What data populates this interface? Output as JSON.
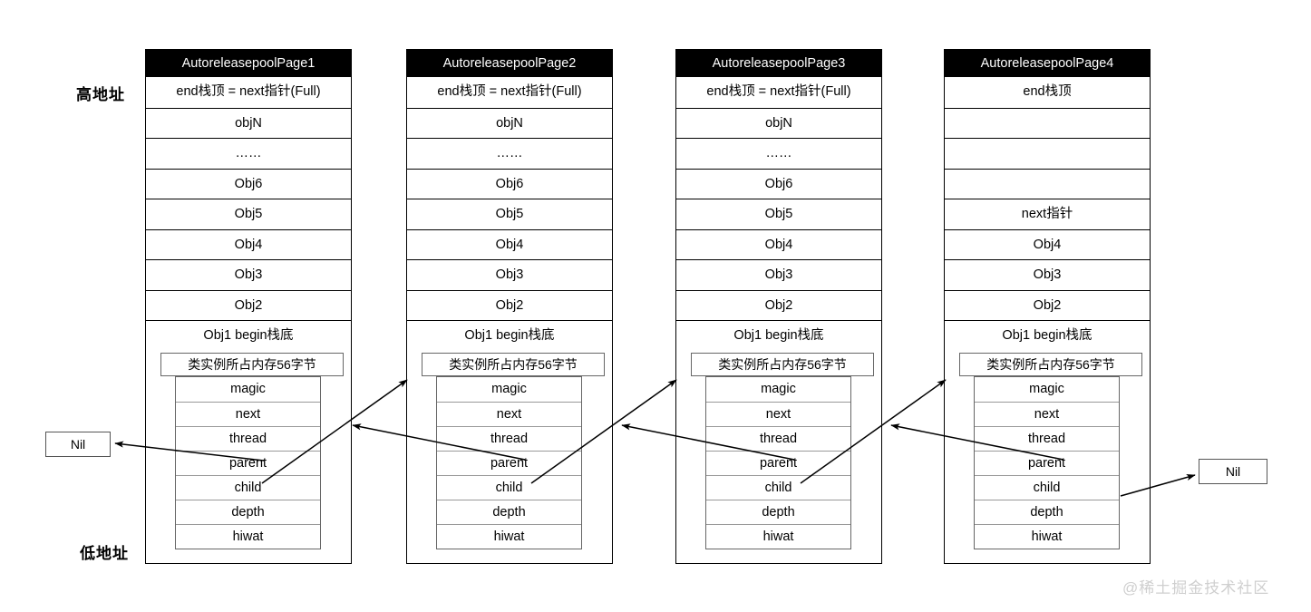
{
  "labels": {
    "high_address": "高地址",
    "low_address": "低地址"
  },
  "watermark": "@稀土掘金技术社区",
  "nil_left": "Nil",
  "nil_right": "Nil",
  "pages": [
    {
      "title": "AutoreleasepoolPage1",
      "slots": [
        "end栈顶 = next指针(Full)",
        "objN",
        "……",
        "Obj6",
        "Obj5",
        "Obj4",
        "Obj3",
        "Obj2",
        "Obj1 begin栈底"
      ],
      "struct_title": "类实例所占内存56字节",
      "fields": [
        "magic",
        "next",
        "thread",
        "parent",
        "child",
        "depth",
        "hiwat"
      ]
    },
    {
      "title": "AutoreleasepoolPage2",
      "slots": [
        "end栈顶 = next指针(Full)",
        "objN",
        "……",
        "Obj6",
        "Obj5",
        "Obj4",
        "Obj3",
        "Obj2",
        "Obj1 begin栈底"
      ],
      "struct_title": "类实例所占内存56字节",
      "fields": [
        "magic",
        "next",
        "thread",
        "parent",
        "child",
        "depth",
        "hiwat"
      ]
    },
    {
      "title": "AutoreleasepoolPage3",
      "slots": [
        "end栈顶 = next指针(Full)",
        "objN",
        "……",
        "Obj6",
        "Obj5",
        "Obj4",
        "Obj3",
        "Obj2",
        "Obj1 begin栈底"
      ],
      "struct_title": "类实例所占内存56字节",
      "fields": [
        "magic",
        "next",
        "thread",
        "parent",
        "child",
        "depth",
        "hiwat"
      ]
    },
    {
      "title": "AutoreleasepoolPage4",
      "slots": [
        "end栈顶",
        "",
        "",
        "",
        "next指针",
        "Obj4",
        "Obj3",
        "Obj2",
        "Obj1 begin栈底"
      ],
      "struct_title": "类实例所占内存56字节",
      "fields": [
        "magic",
        "next",
        "thread",
        "parent",
        "child",
        "depth",
        "hiwat"
      ]
    }
  ],
  "colors": {
    "header_bg": "#000000",
    "header_fg": "#ffffff",
    "border": "#000000",
    "inner_border": "#666666",
    "watermark": "#cfcfcf"
  }
}
